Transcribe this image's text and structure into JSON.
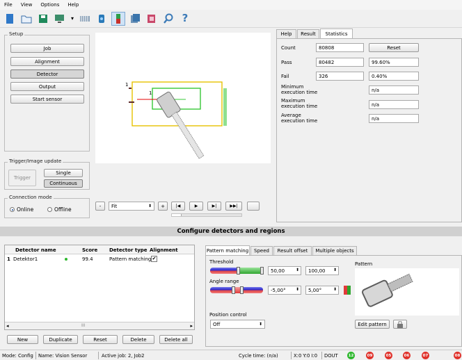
{
  "menu": [
    "File",
    "View",
    "Options",
    "Help"
  ],
  "toolbar_icons": [
    "new-file-icon",
    "open-folder-icon",
    "save-icon",
    "monitor-icon",
    "dropdown-arrow-icon",
    "film-strip-icon",
    "sensor-icon",
    "detector-icon",
    "copy-icon",
    "export-icon",
    "search-icon",
    "help-icon"
  ],
  "setup": {
    "title": "Setup",
    "buttons": [
      "Job",
      "Alignment",
      "Detector",
      "Output",
      "Start sensor"
    ],
    "selected": "Detector"
  },
  "trigger": {
    "title": "Trigger/Image update",
    "trigger_label": "Trigger",
    "single_label": "Single",
    "continuous_label": "Continuous"
  },
  "connection": {
    "title": "Connection mode",
    "online": "Online",
    "offline": "Offline"
  },
  "image_controls": {
    "minus": "-",
    "zoom_value": "Fit",
    "plus": "+",
    "first": "|◀",
    "play": "▶",
    "next": "▶|",
    "last": "▶▶|",
    "marker": "1",
    "roi_label": "1"
  },
  "stats_tabs": [
    "Help",
    "Result",
    "Statistics"
  ],
  "statistics": {
    "count_label": "Count",
    "count": "80808",
    "reset": "Reset",
    "pass_label": "Pass",
    "pass": "80482",
    "pass_pct": "99.60%",
    "fail_label": "Fail",
    "fail": "326",
    "fail_pct": "0.40%",
    "min_label": "Minimum execution time",
    "min": "n/a",
    "max_label": "Maximum execution time",
    "max": "n/a",
    "avg_label": "Average execution time",
    "avg": "n/a"
  },
  "section_title": "Configure detectors and regions",
  "detector_table": {
    "headers": [
      "Detector name",
      "Score",
      "Detector type",
      "Alignment"
    ],
    "row": {
      "index": "1",
      "name": "Detektor1",
      "score": "99.4",
      "type": "Pattern matching",
      "alignment": "✔"
    },
    "scroll_mark": "III"
  },
  "table_buttons": [
    "New",
    "Duplicate",
    "Reset",
    "Delete",
    "Delete all"
  ],
  "pattern_tabs": [
    "Pattern matching",
    "Speed",
    "Result offset",
    "Multiple objects"
  ],
  "pattern": {
    "threshold_label": "Threshold",
    "threshold_min": "50,00",
    "threshold_max": "100,00",
    "angle_label": "Angle range",
    "angle_min": "-5,00°",
    "angle_max": "5,00°",
    "position_label": "Position control",
    "position_value": "Off",
    "pattern_label": "Pattern",
    "edit_pattern": "Edit pattern"
  },
  "status_bar": {
    "mode": "Mode: Config",
    "name": "Name: Vision Sensor",
    "job": "Active job: 2, Job2",
    "cycle": "Cycle time: (n/a)",
    "xyi": "X:0 Y:0 I:0",
    "dout": "DOUT",
    "outputs": [
      {
        "label": "12",
        "color": "#2eb82e"
      },
      {
        "label": "09",
        "color": "#e0312a"
      },
      {
        "label": "05",
        "color": "#e0312a"
      },
      {
        "label": "06",
        "color": "#e0312a"
      },
      {
        "label": "07",
        "color": "#e0312a"
      },
      {
        "label": "08",
        "color": "#e0312a"
      }
    ]
  }
}
